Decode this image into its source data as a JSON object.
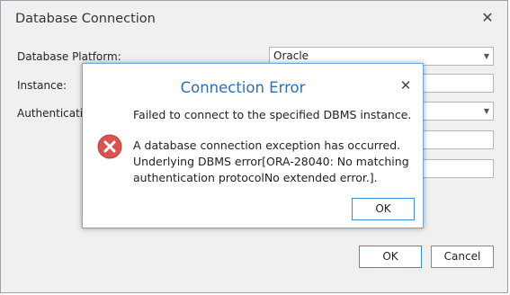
{
  "window": {
    "title": "Database Connection",
    "close_label": "✕"
  },
  "form": {
    "platform_label": "Database Platform:",
    "platform_value": "Oracle",
    "instance_label": "Instance:",
    "instance_value": "",
    "authentication_label": "Authenticatio",
    "authentication_value": "",
    "field4_value": "",
    "field5_value": ""
  },
  "footer": {
    "ok_label": "OK",
    "cancel_label": "Cancel"
  },
  "error_dialog": {
    "title": "Connection Error",
    "close_label": "✕",
    "summary": "Failed to connect to the specified DBMS instance.",
    "detail": "A database connection exception has occurred. Underlying DBMS error[ORA-28040: No matching authentication protocolNo extended error.].",
    "ok_label": "OK",
    "icon": "error-icon",
    "icon_color": "#d9534f"
  }
}
